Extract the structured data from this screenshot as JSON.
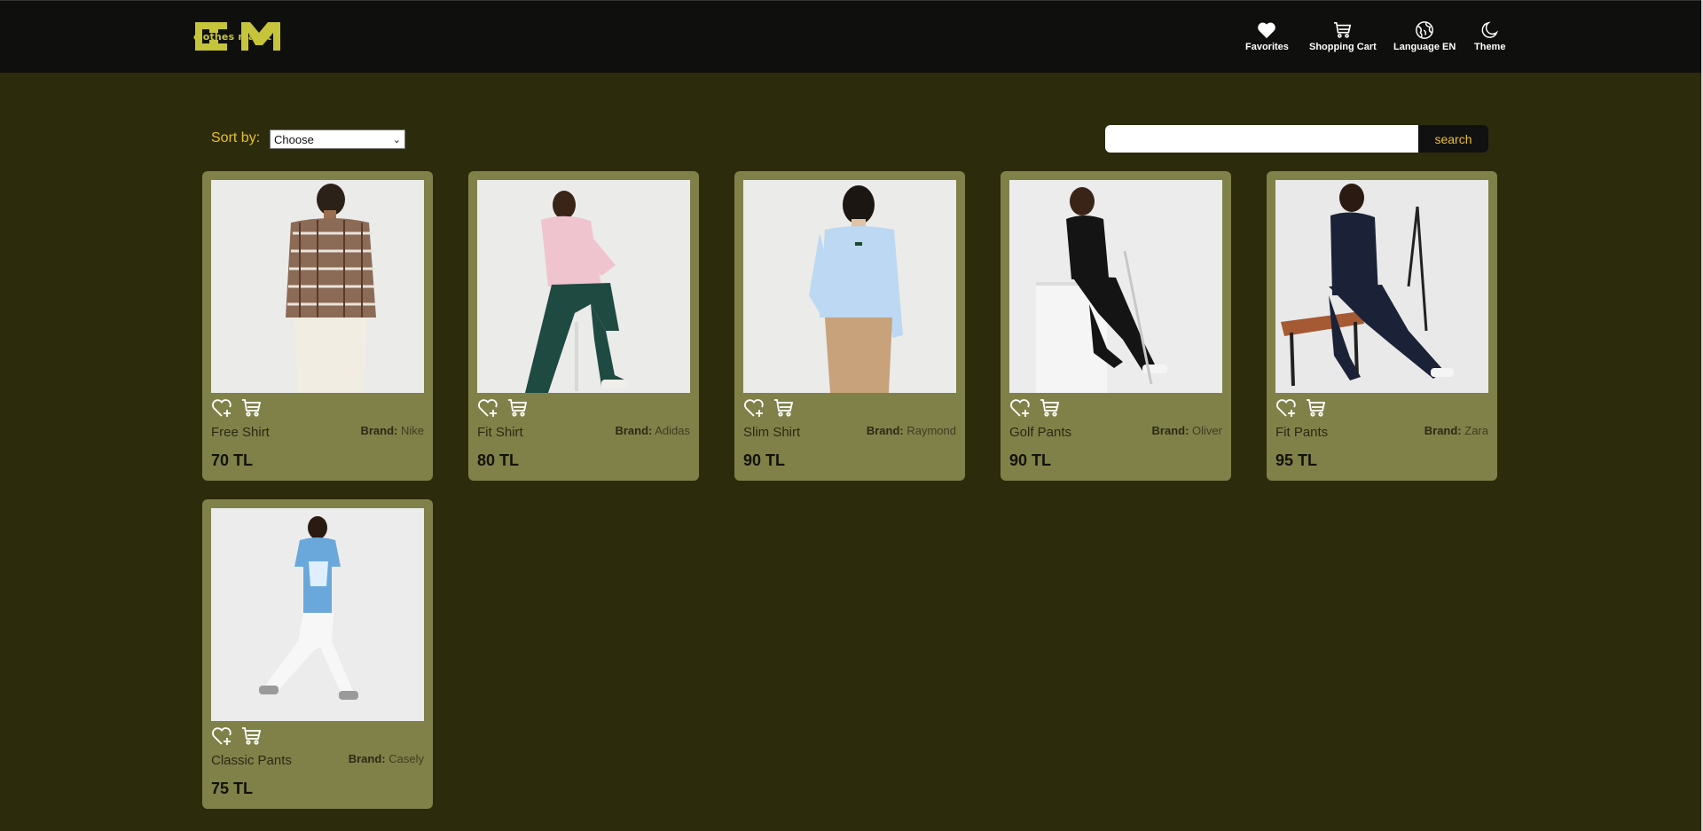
{
  "logo": {
    "text": "clothes markt",
    "mark": "CM"
  },
  "nav": [
    {
      "label": "Favorites",
      "icon": "heart-icon"
    },
    {
      "label": "Shopping Cart",
      "icon": "cart-icon"
    },
    {
      "label": "Language EN",
      "icon": "globe-icon"
    },
    {
      "label": "Theme",
      "icon": "moon-icon"
    }
  ],
  "sort": {
    "label": "Sort by:",
    "selected": "Choose"
  },
  "search": {
    "value": "",
    "button_label": "search"
  },
  "brand_prefix": "Brand:",
  "products": [
    {
      "name": "Free Shirt",
      "brand": "Nike",
      "price": "70 TL"
    },
    {
      "name": "Fit Shirt",
      "brand": "Adidas",
      "price": "80 TL"
    },
    {
      "name": "Slim Shirt",
      "brand": "Raymond",
      "price": "90 TL"
    },
    {
      "name": "Golf Pants",
      "brand": "Oliver",
      "price": "90 TL"
    },
    {
      "name": "Fit Pants",
      "brand": "Zara",
      "price": "95 TL"
    },
    {
      "name": "Classic Pants",
      "brand": "Casely",
      "price": "75 TL"
    }
  ],
  "colors": {
    "page_bg": "#2c2b0c",
    "header_bg": "#0f0f0d",
    "card_bg": "#808149",
    "accent": "#e8c02b",
    "logo": "#c6c43a"
  }
}
